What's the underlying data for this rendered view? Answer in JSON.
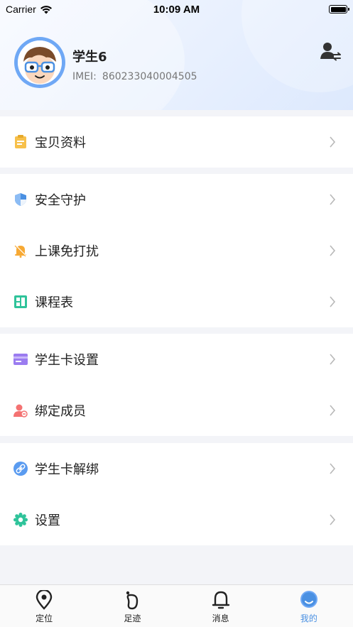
{
  "status_bar": {
    "carrier": "Carrier",
    "time": "10:09 AM"
  },
  "profile": {
    "name": "学生6",
    "imei_label": "IMEI:",
    "imei_value": "860233040004505"
  },
  "menu_groups": [
    [
      {
        "label": "宝贝资料",
        "icon": "profile-card-icon"
      }
    ],
    [
      {
        "label": "安全守护",
        "icon": "shield-icon"
      },
      {
        "label": "上课免打扰",
        "icon": "bell-mute-icon"
      },
      {
        "label": "课程表",
        "icon": "timetable-icon"
      }
    ],
    [
      {
        "label": "学生卡设置",
        "icon": "card-icon"
      },
      {
        "label": "绑定成员",
        "icon": "bind-member-icon"
      }
    ],
    [
      {
        "label": "学生卡解绑",
        "icon": "link-icon"
      },
      {
        "label": "设置",
        "icon": "gear-icon"
      }
    ]
  ],
  "tabs": [
    {
      "label": "定位",
      "icon": "location-pin-icon"
    },
    {
      "label": "足迹",
      "icon": "footprint-icon"
    },
    {
      "label": "消息",
      "icon": "bell-icon"
    },
    {
      "label": "我的",
      "icon": "my-profile-icon",
      "active": true
    }
  ],
  "colors": {
    "accent": "#4a90e2",
    "background": "#f3f4f8"
  }
}
